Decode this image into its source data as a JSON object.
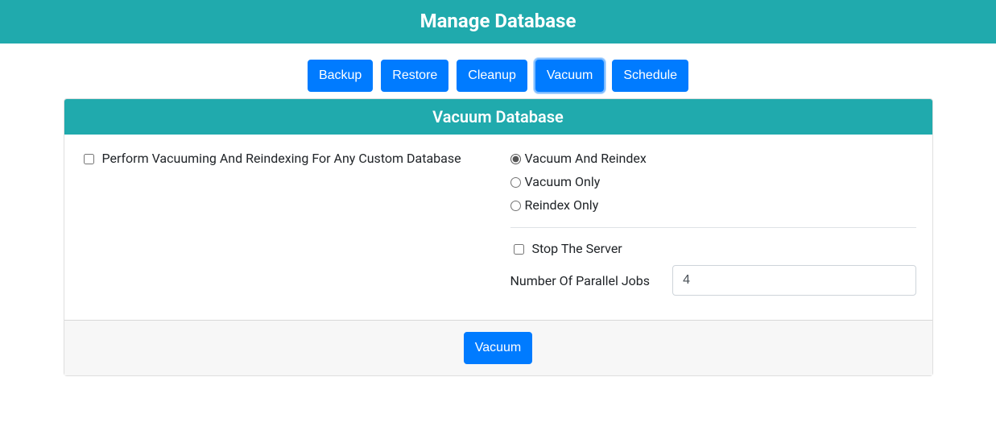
{
  "header": {
    "title": "Manage Database"
  },
  "tabs": {
    "items": [
      {
        "label": "Backup",
        "active": false
      },
      {
        "label": "Restore",
        "active": false
      },
      {
        "label": "Cleanup",
        "active": false
      },
      {
        "label": "Vacuum",
        "active": true
      },
      {
        "label": "Schedule",
        "active": false
      }
    ]
  },
  "panel": {
    "title": "Vacuum Database",
    "custom_db_label": "Perform Vacuuming And Reindexing For Any Custom Database",
    "custom_db_checked": false,
    "mode": {
      "options": [
        {
          "label": "Vacuum And Reindex",
          "checked": true
        },
        {
          "label": "Vacuum Only",
          "checked": false
        },
        {
          "label": "Reindex Only",
          "checked": false
        }
      ]
    },
    "stop_server_label": "Stop The Server",
    "stop_server_checked": false,
    "jobs_label": "Number Of Parallel Jobs",
    "jobs_value": "4",
    "action_label": "Vacuum"
  }
}
